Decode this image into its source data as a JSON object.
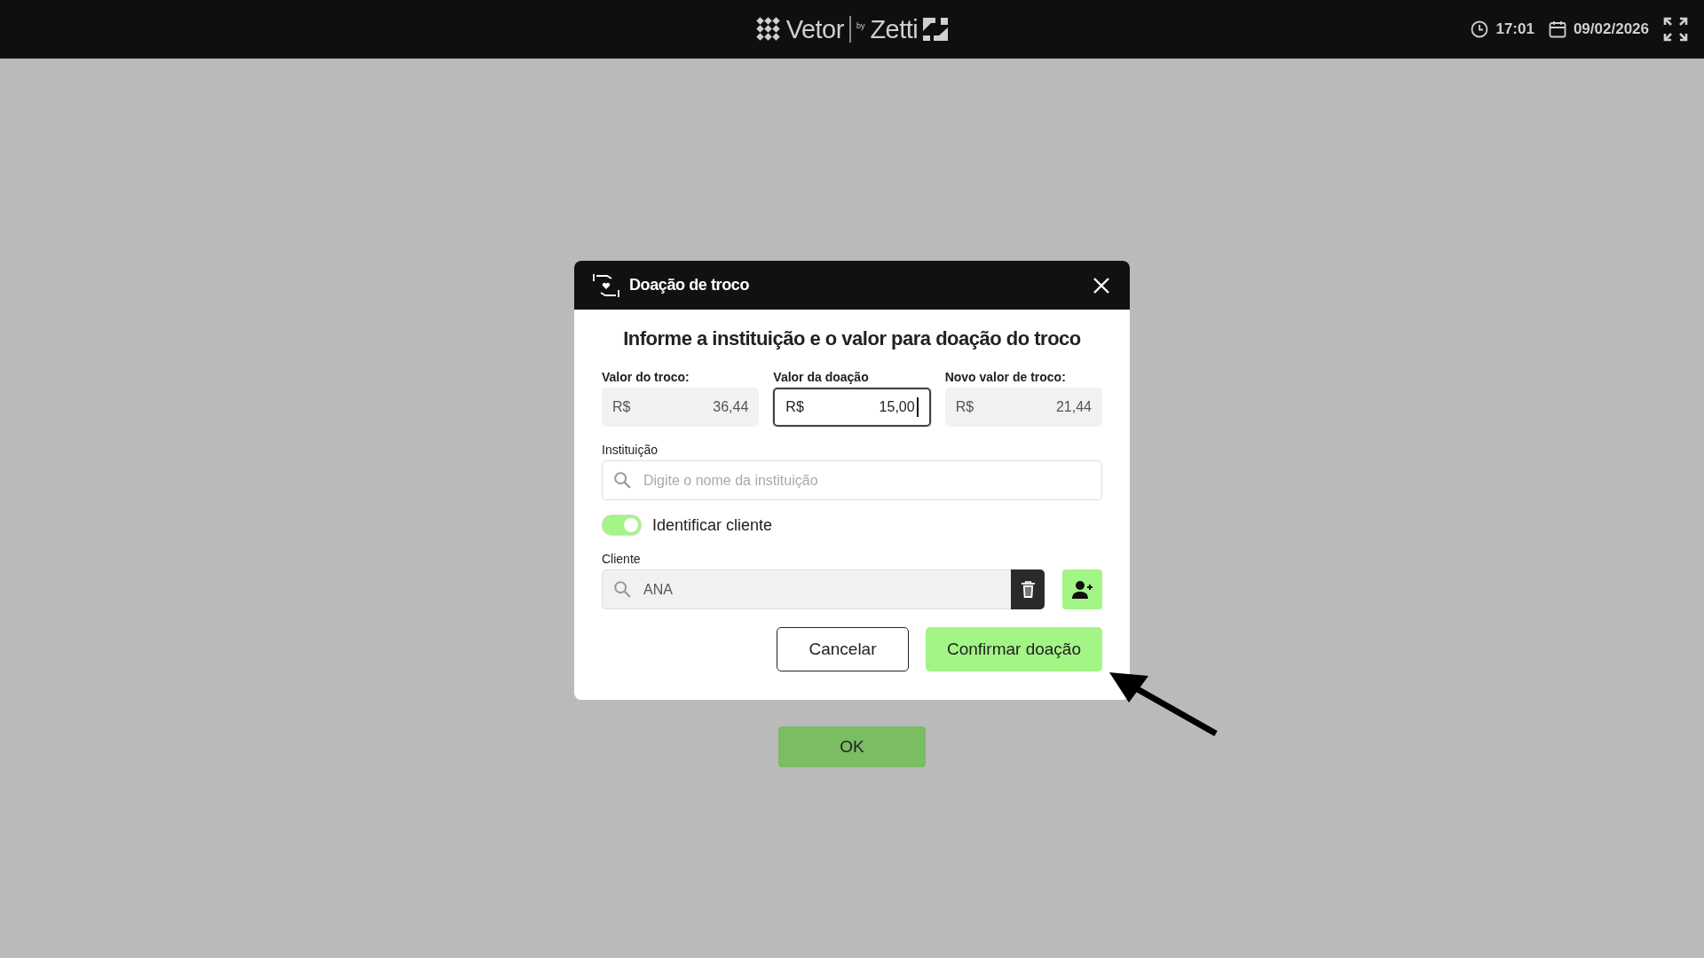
{
  "topbar": {
    "logo": {
      "brand": "Vetor",
      "by": "by",
      "partner": "Zetti"
    },
    "time": "17:01",
    "date": "09/02/2026"
  },
  "background_button": {
    "label": "OK"
  },
  "dialog": {
    "title": "Doação de troco",
    "heading": "Informe a instituição e o valor para doação do troco",
    "amounts": [
      {
        "label": "Valor do troco:",
        "currency": "R$",
        "value": "36,44",
        "editable": false,
        "focused": false
      },
      {
        "label": "Valor da doação",
        "currency": "R$",
        "value": "15,00",
        "editable": true,
        "focused": true
      },
      {
        "label": "Novo valor de troco:",
        "currency": "R$",
        "value": "21,44",
        "editable": false,
        "focused": false
      }
    ],
    "institution": {
      "label": "Instituição",
      "placeholder": "Digite o nome da instituição"
    },
    "identify_client": {
      "label": "Identificar cliente",
      "on": true
    },
    "client": {
      "label": "Cliente",
      "value": "ANA"
    },
    "buttons": [
      {
        "label": "Cancelar",
        "kind": "secondary"
      },
      {
        "label": "Confirmar doação",
        "kind": "primary"
      }
    ]
  }
}
